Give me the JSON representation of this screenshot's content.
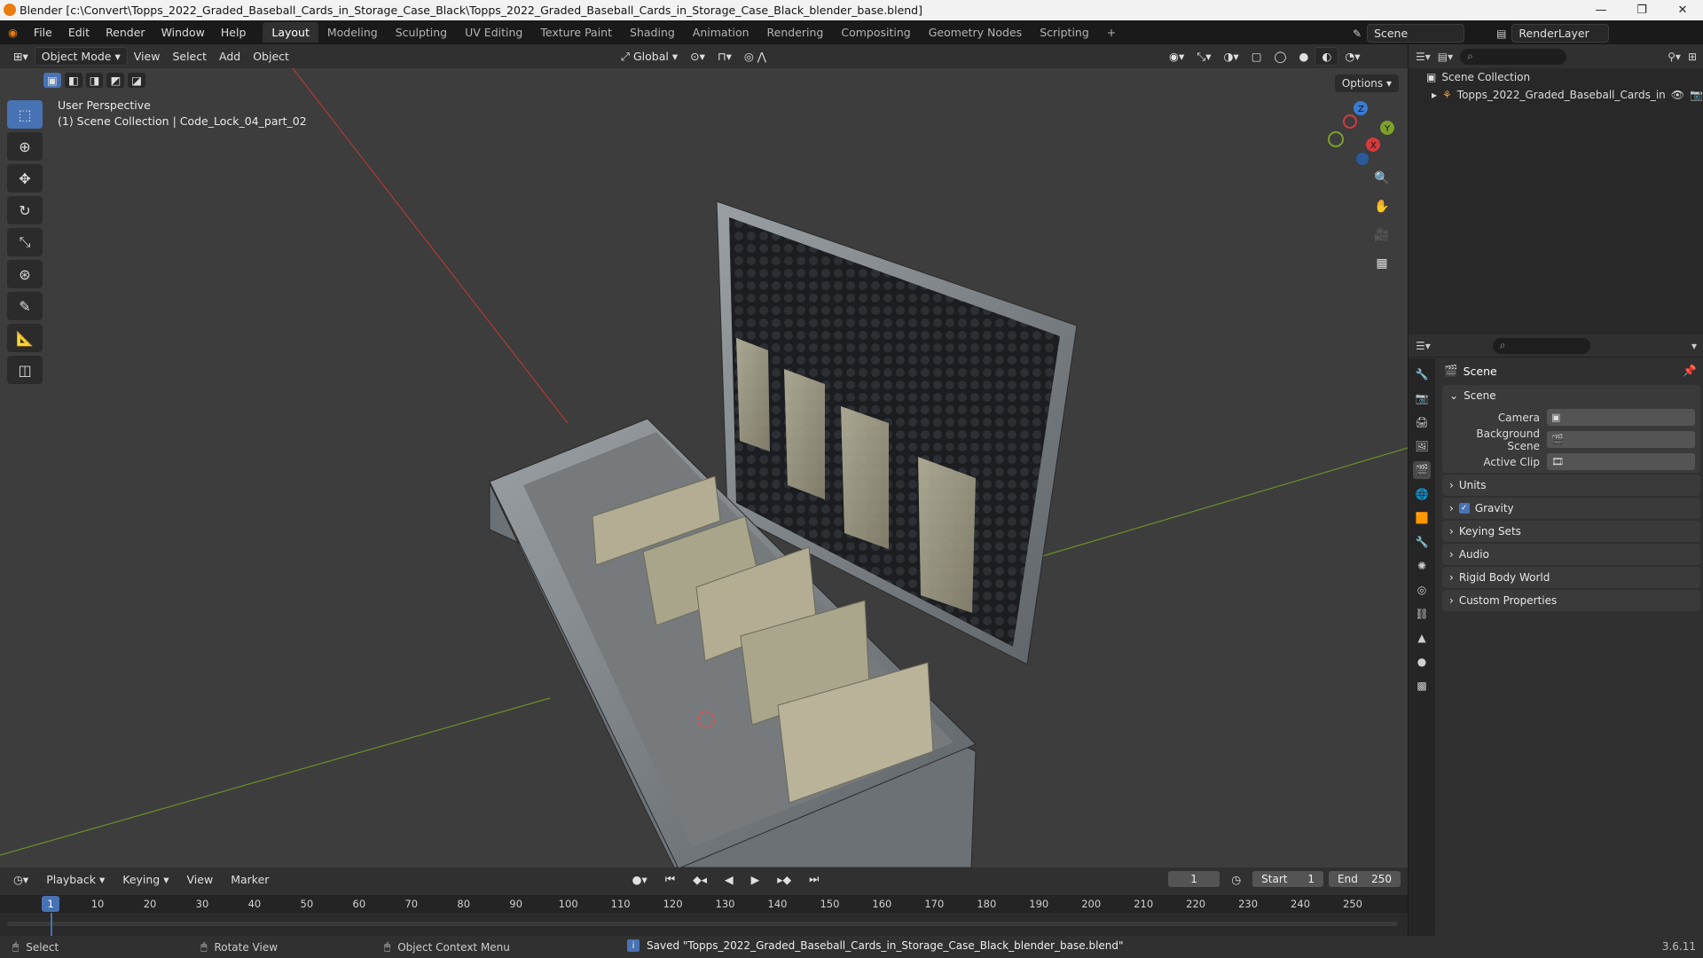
{
  "window": {
    "title": "Blender [c:\\Convert\\Topps_2022_Graded_Baseball_Cards_in_Storage_Case_Black\\Topps_2022_Graded_Baseball_Cards_in_Storage_Case_Black_blender_base.blend]",
    "controls": [
      "—",
      "❐",
      "✕"
    ]
  },
  "menu": [
    "File",
    "Edit",
    "Render",
    "Window",
    "Help"
  ],
  "workspaces": [
    {
      "label": "Layout",
      "active": true
    },
    {
      "label": "Modeling"
    },
    {
      "label": "Sculpting"
    },
    {
      "label": "UV Editing"
    },
    {
      "label": "Texture Paint"
    },
    {
      "label": "Shading"
    },
    {
      "label": "Animation"
    },
    {
      "label": "Rendering"
    },
    {
      "label": "Compositing"
    },
    {
      "label": "Geometry Nodes"
    },
    {
      "label": "Scripting"
    }
  ],
  "topright": {
    "scene": "Scene",
    "render_layer": "RenderLayer"
  },
  "viewport_header": {
    "mode": "Object Mode",
    "menus": [
      "View",
      "Select",
      "Add",
      "Object"
    ],
    "orientation": "Global",
    "options": "Options"
  },
  "viewport": {
    "info_line1": "User Perspective",
    "info_line2": "(1) Scene Collection | Code_Lock_04_part_02",
    "gizmo_axes": [
      "X",
      "Y",
      "Z"
    ]
  },
  "outliner": {
    "root": "Scene Collection",
    "item": "Topps_2022_Graded_Baseball_Cards_in"
  },
  "properties": {
    "context_title": "Scene",
    "scene_panel": "Scene",
    "fields": [
      {
        "label": "Camera"
      },
      {
        "label": "Background Scene"
      },
      {
        "label": "Active Clip"
      }
    ],
    "panels": [
      {
        "label": "Units"
      },
      {
        "label": "Gravity",
        "checked": true
      },
      {
        "label": "Keying Sets"
      },
      {
        "label": "Audio"
      },
      {
        "label": "Rigid Body World"
      },
      {
        "label": "Custom Properties"
      }
    ]
  },
  "timeline": {
    "menus": [
      "Playback",
      "Keying",
      "View",
      "Marker"
    ],
    "current_frame": "1",
    "start_label": "Start",
    "start": "1",
    "end_label": "End",
    "end": "250",
    "ticks": [
      "1",
      "10",
      "20",
      "30",
      "40",
      "50",
      "60",
      "70",
      "80",
      "90",
      "100",
      "110",
      "120",
      "130",
      "140",
      "150",
      "160",
      "170",
      "180",
      "190",
      "200",
      "210",
      "220",
      "230",
      "240",
      "250"
    ]
  },
  "statusbar": {
    "select": "Select",
    "rotate": "Rotate View",
    "context": "Object Context Menu",
    "saved": "Saved \"Topps_2022_Graded_Baseball_Cards_in_Storage_Case_Black_blender_base.blend\"",
    "version": "3.6.11"
  }
}
